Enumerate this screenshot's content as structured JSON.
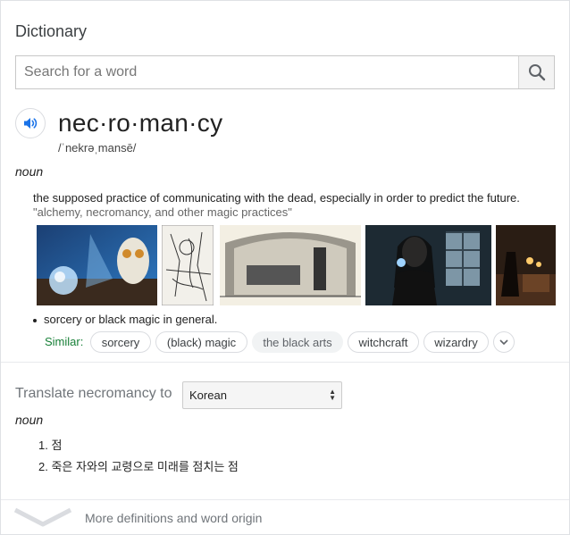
{
  "title": "Dictionary",
  "search": {
    "placeholder": "Search for a word"
  },
  "entry": {
    "word": "nec·ro·man·cy",
    "phonetic": "/ˈnekrəˌmansē/",
    "pos": "noun",
    "definition": "the supposed practice of communicating with the dead, especially in order to predict the future.",
    "example": "\"alchemy, necromancy, and other magic practices\"",
    "sub_definition": "sorcery or black magic in general.",
    "similar_label": "Similar:",
    "similar": [
      "sorcery",
      "(black) magic",
      "the black arts",
      "witchcraft",
      "wizardry"
    ]
  },
  "translate": {
    "label": "Translate necromancy to",
    "language": "Korean",
    "pos": "noun",
    "items": [
      "1. 점",
      "2. 죽은 자와의 교령으로 미래를 점치는 점"
    ]
  },
  "footer": {
    "more_label": "More definitions and word origin"
  },
  "colors": {
    "similar_green": "#188038",
    "speaker_blue": "#1a73e8"
  }
}
